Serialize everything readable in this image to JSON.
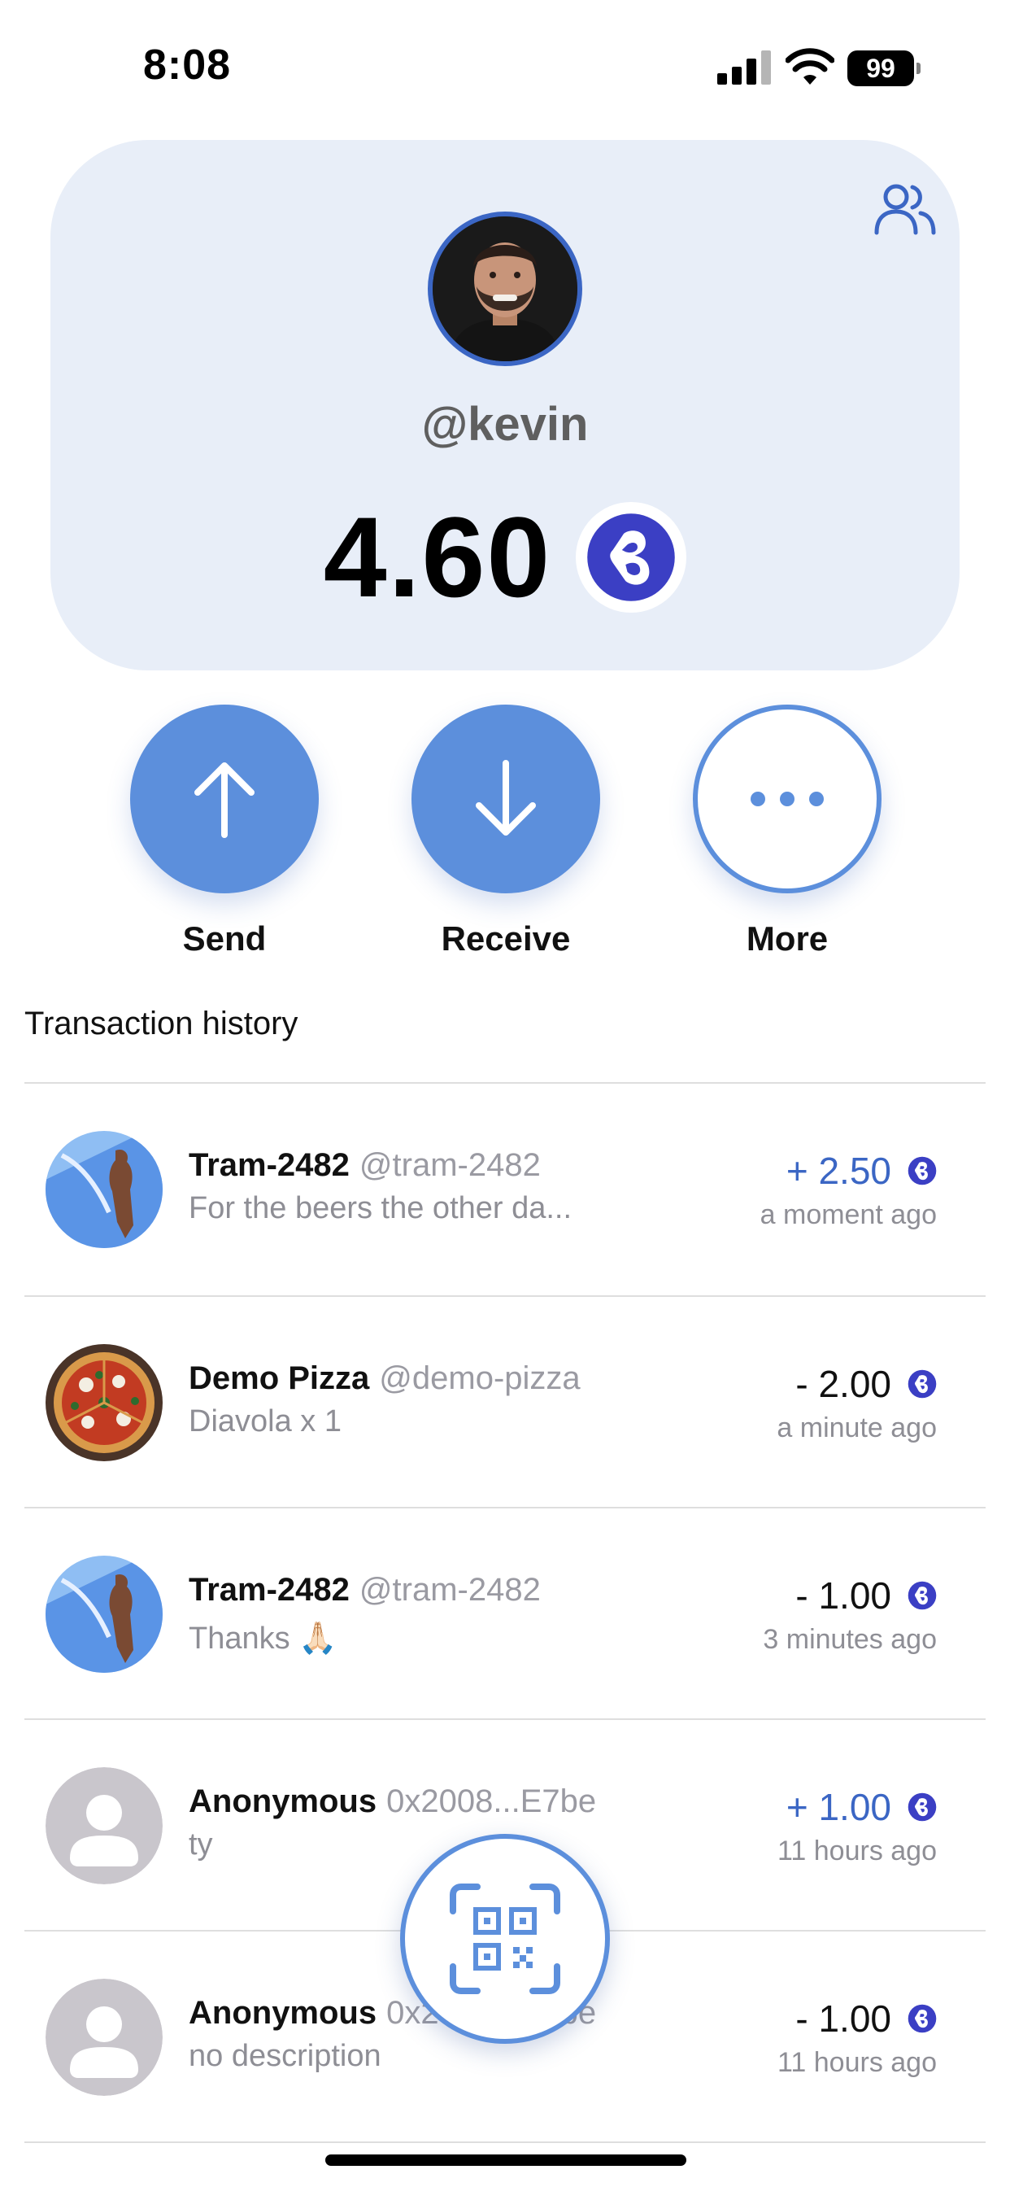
{
  "status_bar": {
    "time": "8:08",
    "battery": "99"
  },
  "profile": {
    "username": "@kevin",
    "balance": "4.60"
  },
  "actions": [
    {
      "label": "Send",
      "icon": "arrow-up-icon"
    },
    {
      "label": "Receive",
      "icon": "arrow-down-icon"
    },
    {
      "label": "More",
      "icon": "more-dots-icon"
    }
  ],
  "transactions_title": "Transaction history",
  "transactions": [
    {
      "name": "Tram-2482",
      "handle": "@tram-2482",
      "description": "For the beers the other da...",
      "amount": "+ 2.50",
      "direction": "in",
      "time": "a moment ago",
      "avatar": "tram-avatar"
    },
    {
      "name": "Demo Pizza",
      "handle": "@demo-pizza",
      "description": "Diavola x 1",
      "amount": "- 2.00",
      "direction": "out",
      "time": "a minute ago",
      "avatar": "pizza-avatar"
    },
    {
      "name": "Tram-2482",
      "handle": "@tram-2482",
      "description": "Thanks 🙏🏻",
      "amount": "- 1.00",
      "direction": "out",
      "time": "3 minutes ago",
      "avatar": "tram-avatar"
    },
    {
      "name": "Anonymous",
      "handle": "0x2008...E7be",
      "description": "ty",
      "amount": "+ 1.00",
      "direction": "in",
      "time": "11 hours ago",
      "avatar": "anonymous-avatar"
    },
    {
      "name": "Anonymous",
      "handle": "0x2008...E7be",
      "description": "no description",
      "amount": "- 1.00",
      "direction": "out",
      "time": "11 hours ago",
      "avatar": "anonymous-avatar"
    }
  ],
  "colors": {
    "accent": "#5c8fdc",
    "positive": "#3b66c4",
    "card_bg": "#e8eef8",
    "token": "#3b3fc4"
  }
}
